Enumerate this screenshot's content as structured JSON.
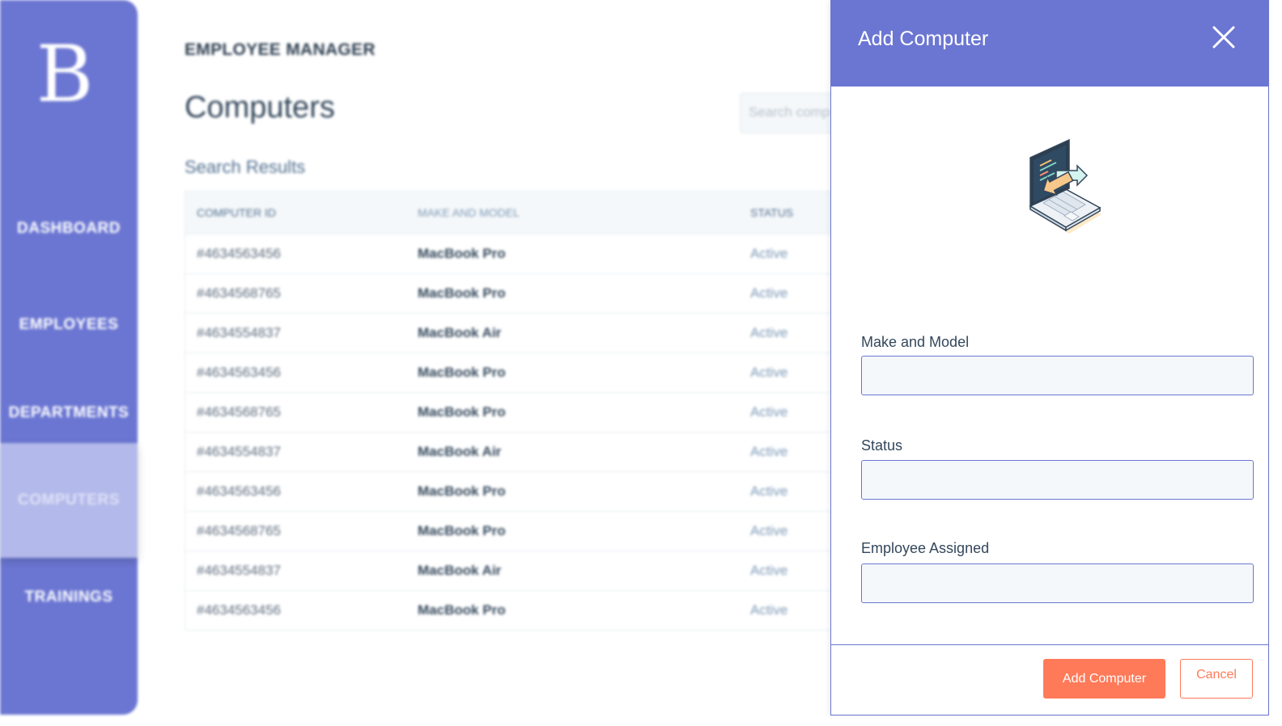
{
  "sidebar": {
    "logo": "B",
    "items": [
      {
        "label": "DASHBOARD"
      },
      {
        "label": "EMPLOYEES"
      },
      {
        "label": "DEPARTMENTS"
      },
      {
        "label": "COMPUTERS",
        "active": true
      },
      {
        "label": "TRAININGS"
      }
    ]
  },
  "main": {
    "app_title": "EMPLOYEE MANAGER",
    "page_title": "Computers",
    "search_placeholder": "Search comp",
    "results_label": "Search Results",
    "table": {
      "columns": [
        "COMPUTER ID",
        "MAKE AND MODEL",
        "STATUS"
      ],
      "rows": [
        [
          "#4634563456",
          "MacBook Pro",
          "Active"
        ],
        [
          "#4634568765",
          "MacBook Pro",
          "Active"
        ],
        [
          "#4634554837",
          "MacBook Air",
          "Active"
        ],
        [
          "#4634563456",
          "MacBook Pro",
          "Active"
        ],
        [
          "#4634568765",
          "MacBook Pro",
          "Active"
        ],
        [
          "#4634554837",
          "MacBook Air",
          "Active"
        ],
        [
          "#4634563456",
          "MacBook Pro",
          "Active"
        ],
        [
          "#4634568765",
          "MacBook Pro",
          "Active"
        ],
        [
          "#4634554837",
          "MacBook Air",
          "Active"
        ],
        [
          "#4634563456",
          "MacBook Pro",
          "Active"
        ]
      ]
    }
  },
  "drawer": {
    "title": "Add Computer",
    "close_icon": "close-icon",
    "illustration_icon": "laptop-transfer-icon",
    "fields": [
      {
        "label": "Make and Model",
        "value": ""
      },
      {
        "label": "Status",
        "value": ""
      },
      {
        "label": "Employee Assigned",
        "value": ""
      }
    ],
    "primary_button": "Add Computer",
    "secondary_button": "Cancel"
  },
  "colors": {
    "brand": "#6b76d2",
    "sidebar_active": "#b3b9ea",
    "accent": "#ff7a59",
    "input_bg": "#f5f8fa"
  }
}
